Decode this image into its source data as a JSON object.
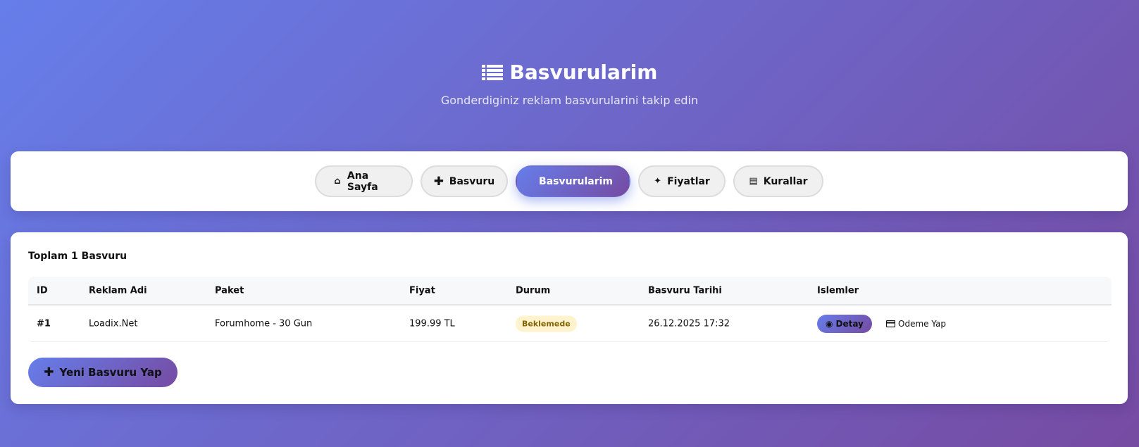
{
  "header": {
    "icon": "list-icon",
    "title": "Basvurularim",
    "subtitle": "Gonderdiginiz reklam basvurularini takip edin"
  },
  "nav": [
    {
      "label": "Ana Sayfa",
      "icon": "home-icon",
      "active": false
    },
    {
      "label": "Basvuru",
      "icon": "plus-icon",
      "active": false
    },
    {
      "label": "Basvurularim",
      "icon": "list-icon",
      "active": true
    },
    {
      "label": "Fiyatlar",
      "icon": "tag-icon",
      "active": false
    },
    {
      "label": "Kurallar",
      "icon": "book-icon",
      "active": false
    }
  ],
  "summary": {
    "total_text": "Toplam 1 Basvuru"
  },
  "table": {
    "headers": [
      "ID",
      "Reklam Adi",
      "Paket",
      "Fiyat",
      "Durum",
      "Basvuru Tarihi",
      "Islemler"
    ],
    "rows": [
      {
        "id": "#1",
        "name": "Loadix.Net",
        "package": "Forumhome - 30 Gun",
        "price": "199.99 TL",
        "status": "Beklemede",
        "date": "26.12.2025 17:32",
        "detail_label": "Detay",
        "pay_label": "Odeme Yap"
      }
    ]
  },
  "new_button": {
    "label": "Yeni Basvuru Yap",
    "icon": "plus-icon"
  },
  "colors": {
    "gradient_start": "#667eea",
    "gradient_end": "#764ba2",
    "status_bg": "#fff3cd",
    "status_text": "#856404"
  }
}
